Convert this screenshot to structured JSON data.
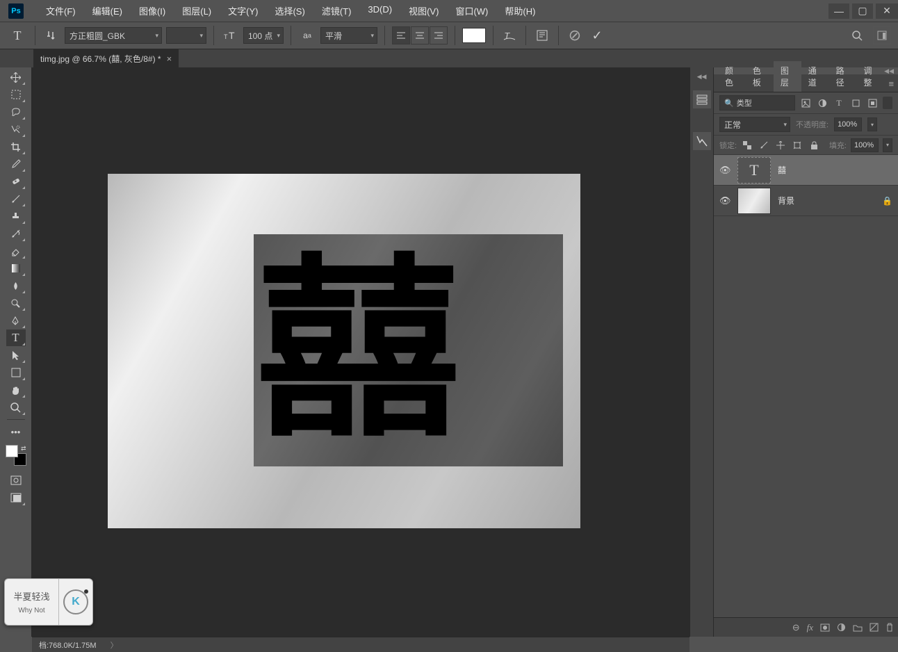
{
  "menubar": {
    "items": [
      "文件(F)",
      "编辑(E)",
      "图像(I)",
      "图层(L)",
      "文字(Y)",
      "选择(S)",
      "滤镜(T)",
      "3D(D)",
      "视图(V)",
      "窗口(W)",
      "帮助(H)"
    ]
  },
  "options": {
    "font_family": "方正粗圆_GBK",
    "font_size": "100 点",
    "aa_label": "平滑",
    "aa_icon": "aa"
  },
  "doc_tab": {
    "label": "timg.jpg @ 66.7% (囍, 灰色/8#) *"
  },
  "canvas": {
    "text": "囍"
  },
  "panel": {
    "tabs": [
      "颜色",
      "色板",
      "图层",
      "通道",
      "路径",
      "调整"
    ],
    "filter_placeholder": "类型",
    "blend_mode": "正常",
    "opacity_label": "不透明度:",
    "opacity_value": "100%",
    "lock_label": "锁定:",
    "fill_label": "填充:",
    "fill_value": "100%",
    "layers": [
      {
        "name": "囍",
        "type": "text",
        "locked": false
      },
      {
        "name": "背景",
        "type": "bg",
        "locked": true
      }
    ]
  },
  "status": {
    "doc_info": "档:768.0K/1.75M"
  },
  "watermark": {
    "title": "半夏轻浅",
    "sub": "Why Not",
    "logo": "K"
  }
}
